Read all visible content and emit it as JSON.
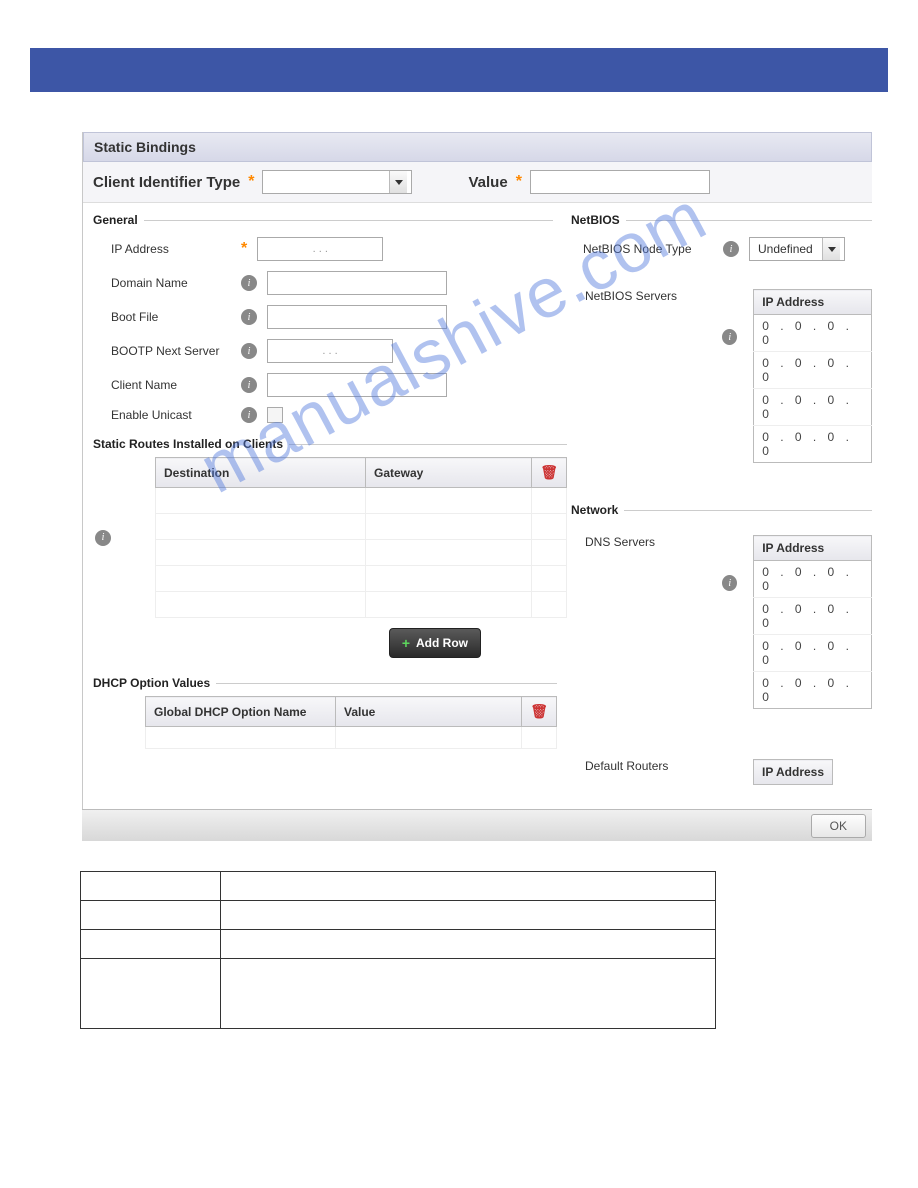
{
  "panel": {
    "title": "Static Bindings"
  },
  "header": {
    "client_id_type_label": "Client Identifier Type",
    "client_id_type_value": "",
    "value_label": "Value",
    "value_text": ""
  },
  "general": {
    "legend": "General",
    "ip_address_label": "IP Address",
    "ip_address_value": ".   .   .",
    "domain_name_label": "Domain Name",
    "domain_name_value": "",
    "boot_file_label": "Boot File",
    "boot_file_value": "",
    "bootp_next_label": "BOOTP Next Server",
    "bootp_next_value": ".   .   .",
    "client_name_label": "Client Name",
    "client_name_value": "",
    "enable_unicast_label": "Enable Unicast"
  },
  "routes": {
    "legend": "Static Routes Installed on Clients",
    "col_destination": "Destination",
    "col_gateway": "Gateway",
    "add_row_label": "Add Row"
  },
  "dhcp_options": {
    "legend": "DHCP Option Values",
    "col_name": "Global DHCP Option Name",
    "col_value": "Value"
  },
  "netbios": {
    "legend": "NetBIOS",
    "node_type_label": "NetBIOS Node Type",
    "node_type_value": "Undefined",
    "servers_label": "NetBIOS Servers",
    "ip_header": "IP Address",
    "rows": [
      "0 . 0 . 0 . 0",
      "0 . 0 . 0 . 0",
      "0 . 0 . 0 . 0",
      "0 . 0 . 0 . 0"
    ]
  },
  "network": {
    "legend": "Network",
    "dns_label": "DNS Servers",
    "ip_header": "IP Address",
    "rows": [
      "0 . 0 . 0 . 0",
      "0 . 0 . 0 . 0",
      "0 . 0 . 0 . 0",
      "0 . 0 . 0 . 0"
    ],
    "default_routers_label": "Default Routers",
    "default_routers_header": "IP Address"
  },
  "footer": {
    "ok_label": "OK"
  },
  "watermark": "manualshive.com"
}
